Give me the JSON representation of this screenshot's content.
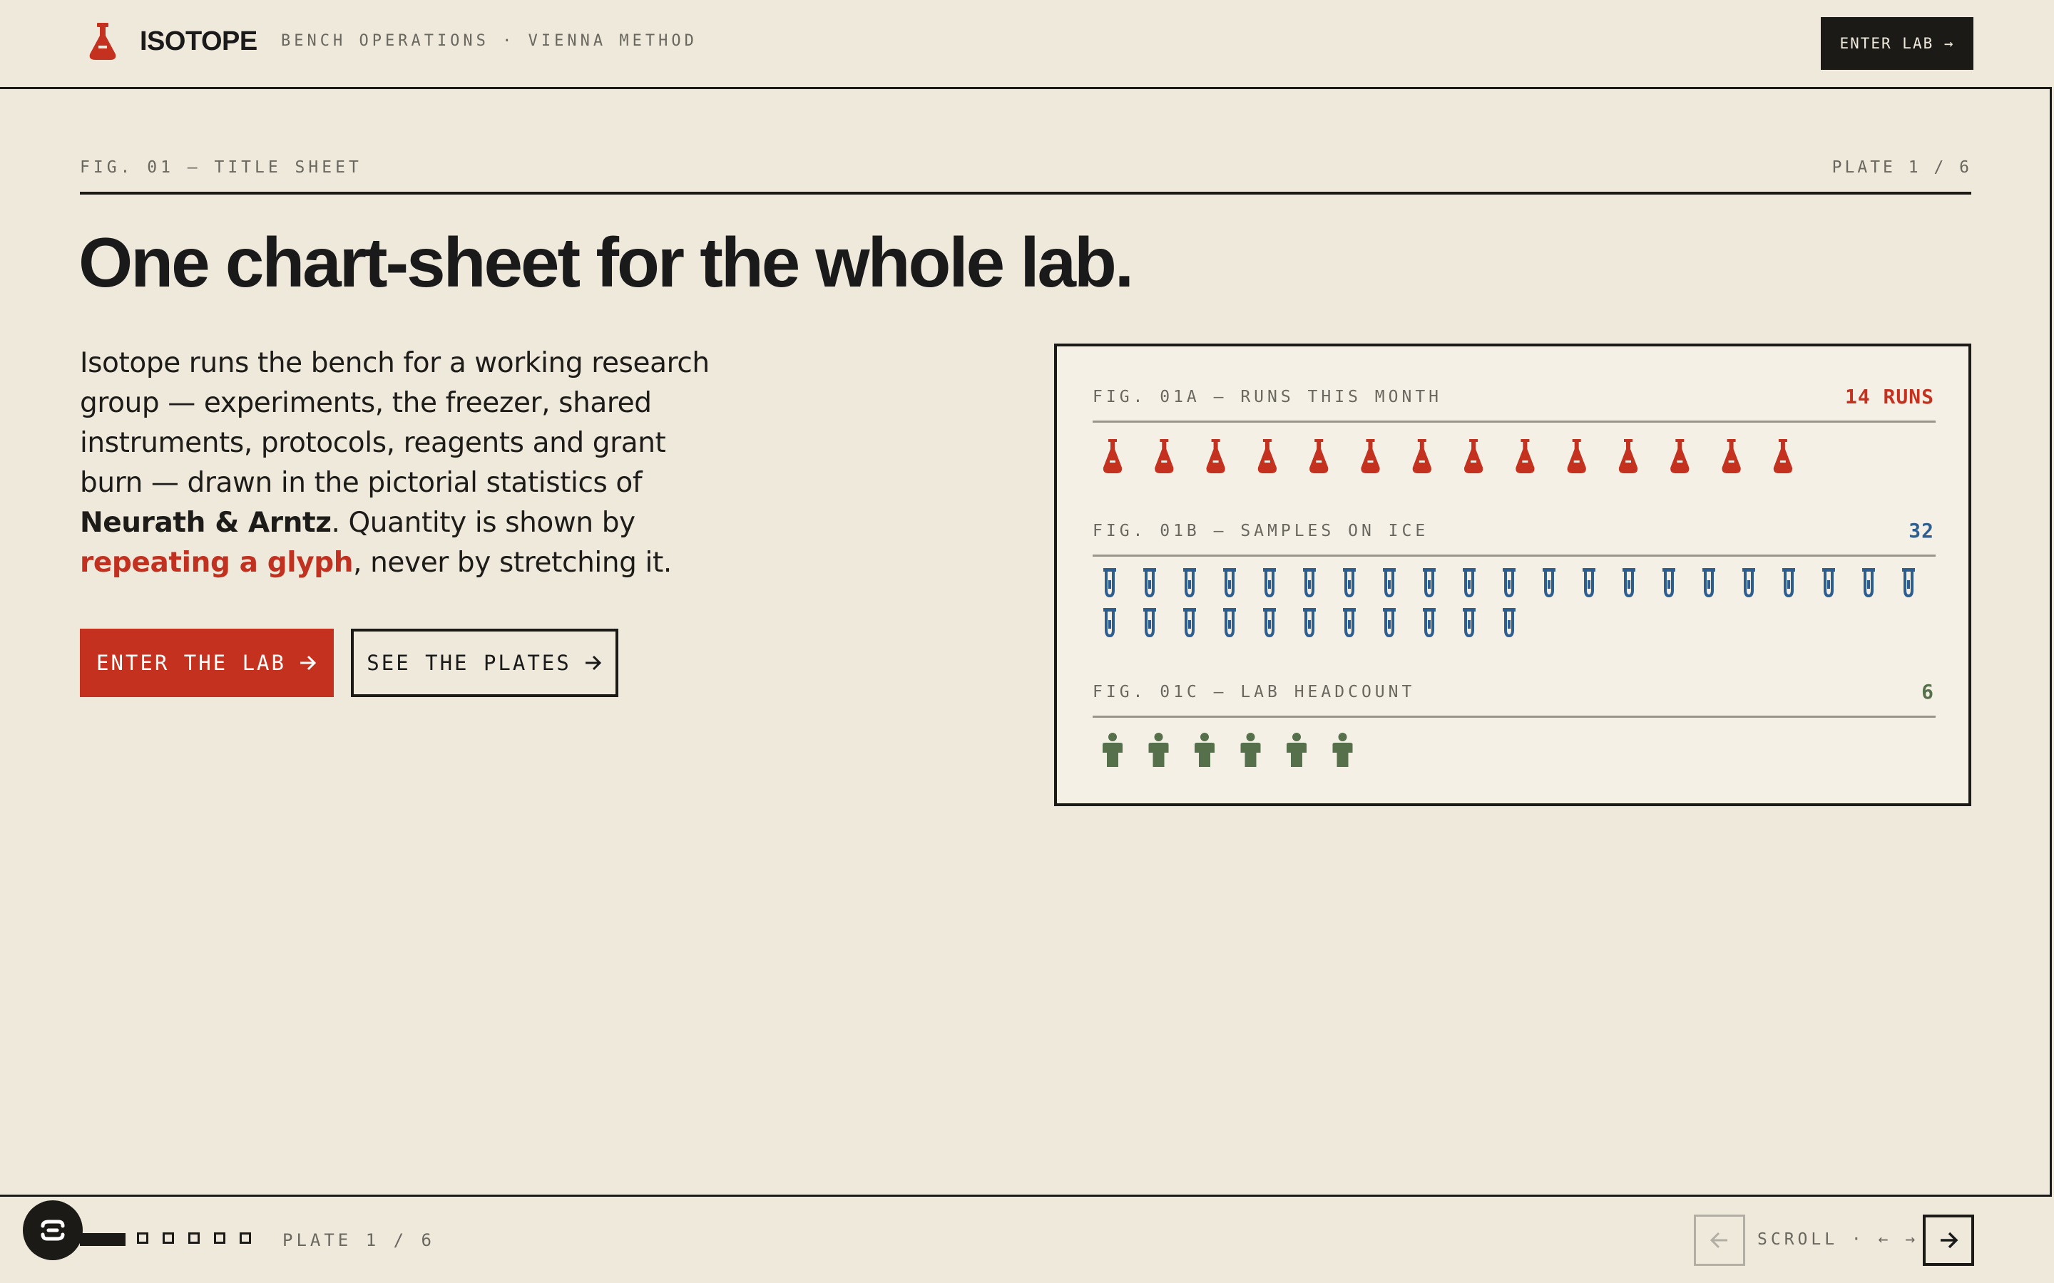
{
  "header": {
    "brand": "ISOTOPE",
    "tagline": "BENCH OPERATIONS · VIENNA METHOD",
    "enter_lab": "ENTER LAB →"
  },
  "plate": {
    "fig_label": "FIG. 01 — TITLE SHEET",
    "plate_label": "PLATE 1 / 6",
    "headline": "One chart-sheet for the whole lab.",
    "lede": {
      "part1": "Isotope runs the bench for a working research group — experiments, the freezer, shared instruments, protocols, reagents and grant burn — drawn in the pictorial statistics of ",
      "bold": "Neurath & Arntz",
      "part2": ". Quantity is shown by ",
      "accent": "repeating a glyph",
      "part3": ", never by stretching it."
    },
    "cta_primary": "ENTER THE LAB",
    "cta_secondary": "SEE THE PLATES"
  },
  "chart_data": [
    {
      "type": "pictogram",
      "title": "FIG. 01A — RUNS THIS MONTH",
      "value_label": "14 RUNS",
      "value": 14,
      "glyph": "flask-icon",
      "color": "#c4321f"
    },
    {
      "type": "pictogram",
      "title": "FIG. 01B — SAMPLES ON ICE",
      "value_label": "32",
      "value": 32,
      "glyph": "test-tube-icon",
      "color": "#2e5d8f"
    },
    {
      "type": "pictogram",
      "title": "FIG. 01C — LAB HEADCOUNT",
      "value_label": "6",
      "value": 6,
      "glyph": "person-icon",
      "color": "#55704a"
    }
  ],
  "footer": {
    "plate_label": "PLATE 1 / 6",
    "scroll_hint": "SCROLL · ← →",
    "total_plates": 6,
    "current_plate": 1
  },
  "colors": {
    "background": "#efe9dc",
    "ink": "#1b1a17",
    "accent_red": "#c4321f",
    "accent_blue": "#2e5d8f",
    "accent_green": "#55704a"
  }
}
